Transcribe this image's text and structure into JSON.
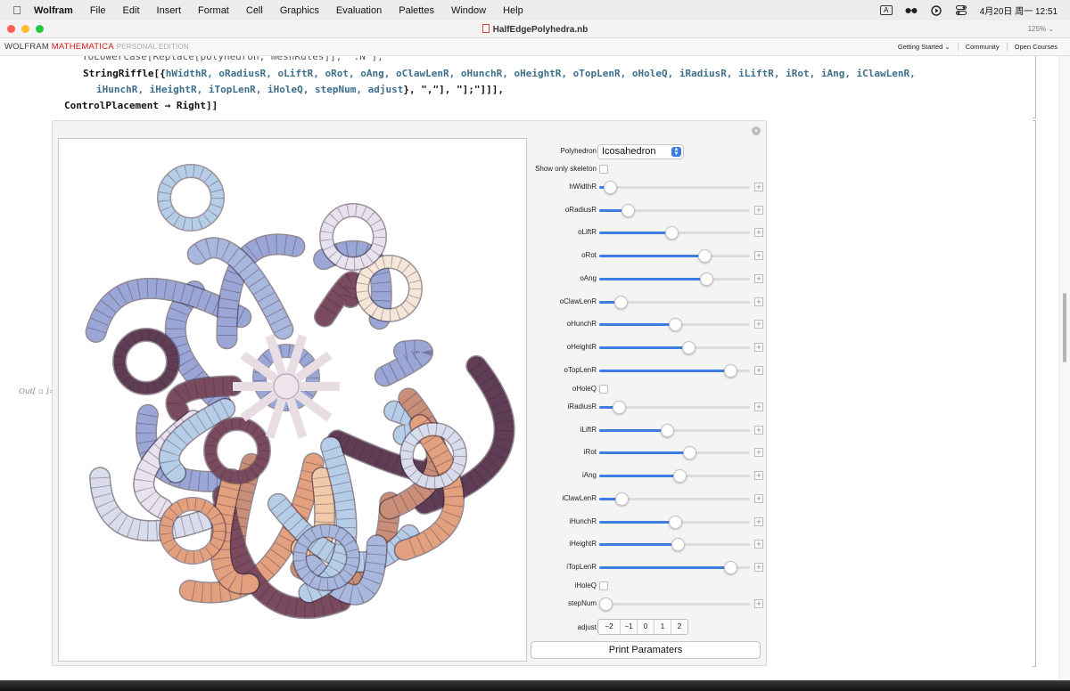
{
  "menubar": {
    "app": "Wolfram",
    "items": [
      "File",
      "Edit",
      "Insert",
      "Format",
      "Cell",
      "Graphics",
      "Evaluation",
      "Palettes",
      "Window",
      "Help"
    ],
    "input_indicator": "A",
    "datetime": "4月20日 周一  12:51"
  },
  "window": {
    "title": "HalfEdgePolyhedra.nb",
    "zoom": "125%"
  },
  "brandbar": {
    "brand_a": "WOLFRAM ",
    "brand_b": "MATHEMATICA",
    "edition": "PERSONAL EDITION",
    "links": [
      "Getting Started ⌄",
      "Community",
      "Open Courses"
    ]
  },
  "code": {
    "line0": "ToLowerCase[Replace[polyhedron, meshRules]], \".N\"],",
    "line1_fn": "StringRiffle[{",
    "line1_vars": "hWidthR, oRadiusR, oLiftR, oRot, oAng, oClawLenR, oHunchR, oHeightR, oTopLenR, oHoleQ, iRadiusR, iLiftR, iRot, iAng, iClawLenR,",
    "line2_vars": "iHunchR, iHeightR, iTopLenR, iHoleQ, stepNum, adjust",
    "line2_tail": "}, \",\"], \"];\"]]],",
    "line3": "ControlPlacement → Right]]"
  },
  "out_label": "Out[ ▫ ]=",
  "controls": {
    "polyhedron_label": "Polyhedron",
    "polyhedron_value": "Icosahedron",
    "skeleton_label": "Show only skeleton",
    "sliders": [
      {
        "name": "hWidthR",
        "value": 0.07
      },
      {
        "name": "oRadiusR",
        "value": 0.19
      },
      {
        "name": "oLiftR",
        "value": 0.48
      },
      {
        "name": "oRot",
        "value": 0.7
      },
      {
        "name": "oAng",
        "value": 0.71
      },
      {
        "name": "oClawLenR",
        "value": 0.14
      },
      {
        "name": "oHunchR",
        "value": 0.5
      },
      {
        "name": "oHeightR",
        "value": 0.59
      },
      {
        "name": "oTopLenR",
        "value": 0.87
      }
    ],
    "ohole_label": "oHoleQ",
    "sliders2": [
      {
        "name": "iRadiusR",
        "value": 0.13
      },
      {
        "name": "iLiftR",
        "value": 0.45
      },
      {
        "name": "iRot",
        "value": 0.6
      },
      {
        "name": "iAng",
        "value": 0.53
      },
      {
        "name": "iClawLenR",
        "value": 0.15
      },
      {
        "name": "iHunchR",
        "value": 0.5
      },
      {
        "name": "iHeightR",
        "value": 0.52
      },
      {
        "name": "iTopLenR",
        "value": 0.87
      }
    ],
    "ihole_label": "iHoleQ",
    "step_label": "stepNum",
    "step_value": 0.04,
    "adjust_label": "adjust",
    "adjust_options": [
      "−2",
      "−1",
      "0",
      "1",
      "2"
    ],
    "print_label": "Print Paramaters"
  },
  "colors": {
    "accent": "#3d7de0",
    "brand_red": "#d32020",
    "close": "#ff5f57",
    "minimize": "#febc2e",
    "maximize": "#28c840"
  }
}
